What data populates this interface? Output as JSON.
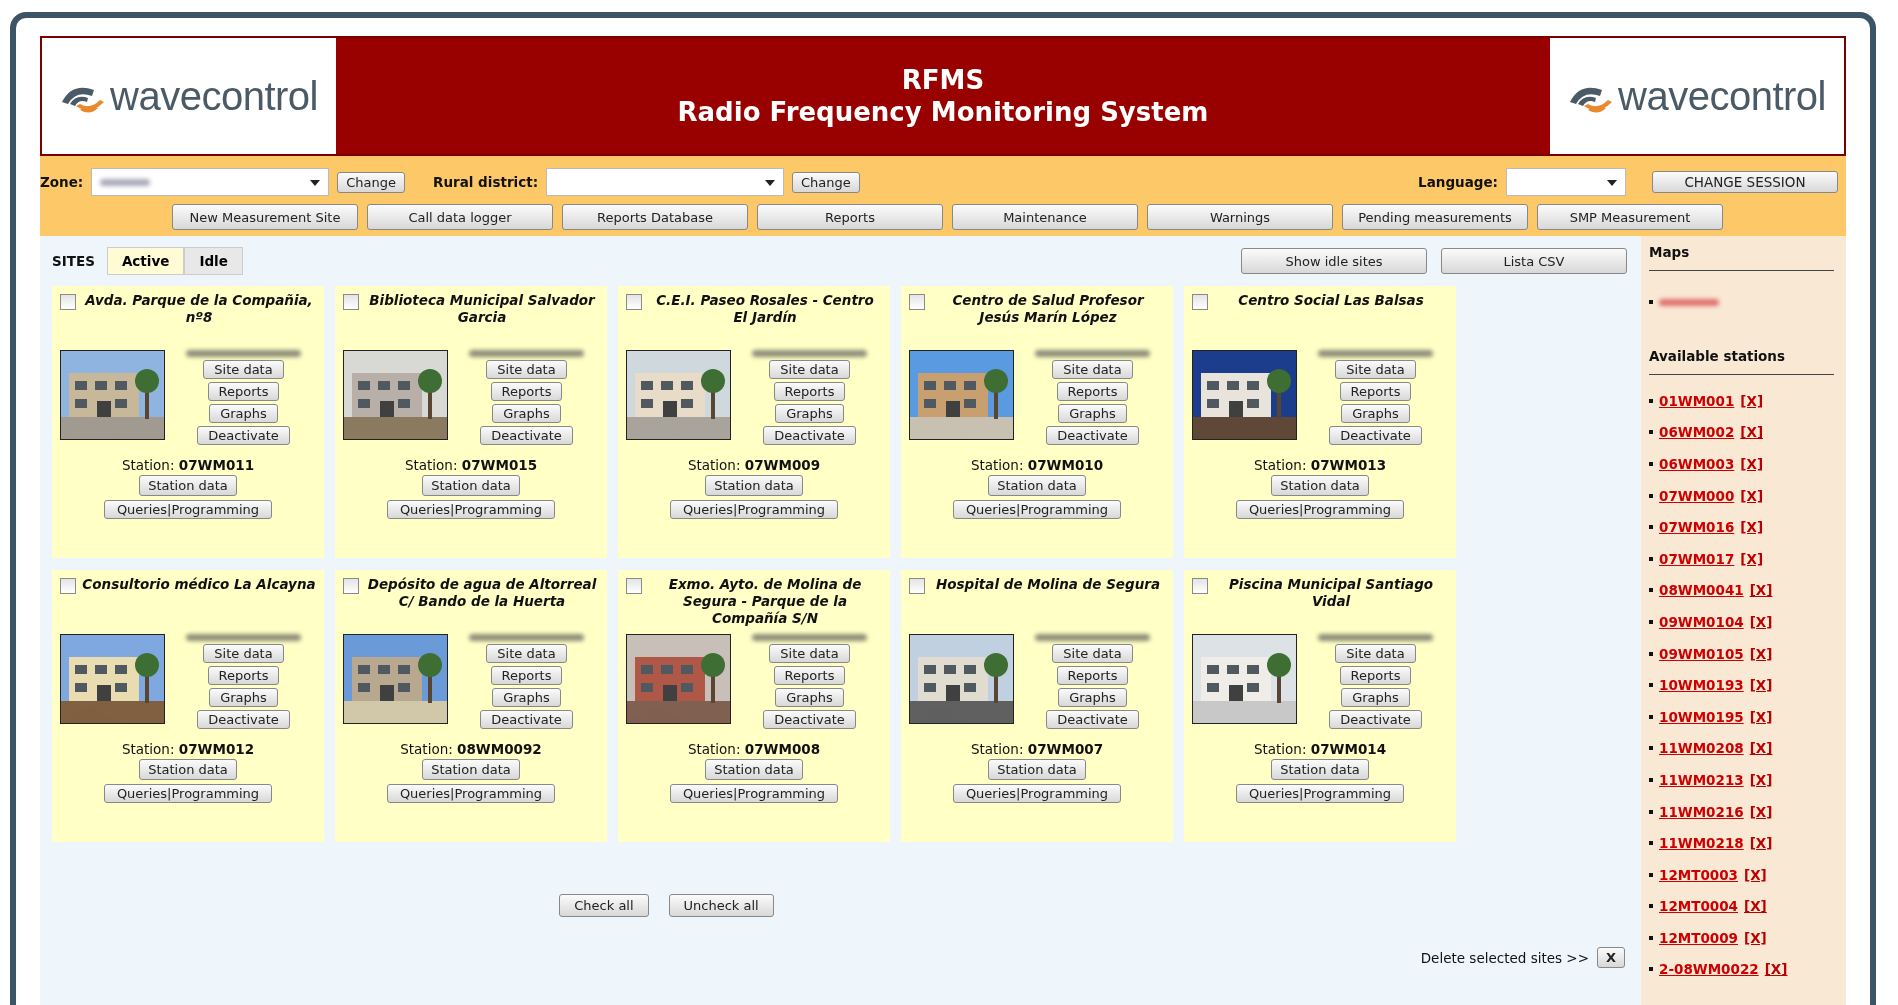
{
  "header": {
    "logo_left": "wavecontrol",
    "title": "RFMS",
    "subtitle": "Radio Frequency Monitoring System",
    "logo_right": "wavecontrol"
  },
  "filters": {
    "zone_label": "Zone:",
    "zone_button": "Change",
    "district_label": "Rural district:",
    "district_button": "Change",
    "language_label": "Language:",
    "session_button": "CHANGE SESSION"
  },
  "nav": [
    "New Measurement Site",
    "Call data logger",
    "Reports Database",
    "Reports",
    "Maintenance",
    "Warnings",
    "Pending measurements",
    "SMP Measurement"
  ],
  "sites_label": "SITES",
  "tabs": [
    {
      "label": "Active",
      "selected": true
    },
    {
      "label": "Idle",
      "selected": false
    }
  ],
  "actions": [
    "Show idle sites",
    "Lista CSV"
  ],
  "sites": [
    {
      "name": "Avda. Parque de la Compañia, nº8",
      "checked": false,
      "buttons": [
        "Site data",
        "Reports",
        "Graphs",
        "Deactivate"
      ],
      "station_label": "Station:",
      "station": "07WM011",
      "station_button": "Station data",
      "queries": "Queries|Programming"
    },
    {
      "name": "Biblioteca Municipal Salvador Garcia",
      "checked": false,
      "buttons": [
        "Site data",
        "Reports",
        "Graphs",
        "Deactivate"
      ],
      "station_label": "Station:",
      "station": "07WM015",
      "station_button": "Station data",
      "queries": "Queries|Programming"
    },
    {
      "name": "C.E.I. Paseo Rosales - Centro El Jardín",
      "checked": false,
      "buttons": [
        "Site data",
        "Reports",
        "Graphs",
        "Deactivate"
      ],
      "station_label": "Station:",
      "station": "07WM009",
      "station_button": "Station data",
      "queries": "Queries|Programming"
    },
    {
      "name": "Centro de Salud Profesor Jesús Marín López",
      "checked": false,
      "buttons": [
        "Site data",
        "Reports",
        "Graphs",
        "Deactivate"
      ],
      "station_label": "Station:",
      "station": "07WM010",
      "station_button": "Station data",
      "queries": "Queries|Programming"
    },
    {
      "name": "Centro Social Las Balsas",
      "checked": false,
      "buttons": [
        "Site data",
        "Reports",
        "Graphs",
        "Deactivate"
      ],
      "station_label": "Station:",
      "station": "07WM013",
      "station_button": "Station data",
      "queries": "Queries|Programming"
    },
    {
      "name": "Consultorio médico La Alcayna",
      "checked": false,
      "buttons": [
        "Site data",
        "Reports",
        "Graphs",
        "Deactivate"
      ],
      "station_label": "Station:",
      "station": "07WM012",
      "station_button": "Station data",
      "queries": "Queries|Programming"
    },
    {
      "name": "Depósito de agua de Altorreal C/ Bando de la Huerta",
      "checked": false,
      "buttons": [
        "Site data",
        "Reports",
        "Graphs",
        "Deactivate"
      ],
      "station_label": "Station:",
      "station": "08WM0092",
      "station_button": "Station data",
      "queries": "Queries|Programming"
    },
    {
      "name": "Exmo. Ayto. de Molina de Segura - Parque de la Compañía S/N",
      "checked": false,
      "buttons": [
        "Site data",
        "Reports",
        "Graphs",
        "Deactivate"
      ],
      "station_label": "Station:",
      "station": "07WM008",
      "station_button": "Station data",
      "queries": "Queries|Programming"
    },
    {
      "name": "Hospital de Molina de Segura",
      "checked": false,
      "buttons": [
        "Site data",
        "Reports",
        "Graphs",
        "Deactivate"
      ],
      "station_label": "Station:",
      "station": "07WM007",
      "station_button": "Station data",
      "queries": "Queries|Programming"
    },
    {
      "name": "Piscina Municipal Santiago Vidal",
      "checked": false,
      "buttons": [
        "Site data",
        "Reports",
        "Graphs",
        "Deactivate"
      ],
      "station_label": "Station:",
      "station": "07WM014",
      "station_button": "Station data",
      "queries": "Queries|Programming"
    }
  ],
  "bulk": [
    "Check all",
    "Uncheck all"
  ],
  "delete": {
    "label": "Delete selected sites >>",
    "button": "X"
  },
  "sidebar": {
    "maps_title": "Maps",
    "stations_title": "Available stations",
    "stations": [
      {
        "name": "01WM001",
        "remove": "[X]"
      },
      {
        "name": "06WM002",
        "remove": "[X]"
      },
      {
        "name": "06WM003",
        "remove": "[X]"
      },
      {
        "name": "07WM000",
        "remove": "[X]"
      },
      {
        "name": "07WM016",
        "remove": "[X]"
      },
      {
        "name": "07WM017",
        "remove": "[X]"
      },
      {
        "name": "08WM0041",
        "remove": "[X]"
      },
      {
        "name": "09WM0104",
        "remove": "[X]"
      },
      {
        "name": "09WM0105",
        "remove": "[X]"
      },
      {
        "name": "10WM0193",
        "remove": "[X]"
      },
      {
        "name": "10WM0195",
        "remove": "[X]"
      },
      {
        "name": "11WM0208",
        "remove": "[X]"
      },
      {
        "name": "11WM0213",
        "remove": "[X]"
      },
      {
        "name": "11WM0216",
        "remove": "[X]"
      },
      {
        "name": "11WM0218",
        "remove": "[X]"
      },
      {
        "name": "12MT0003",
        "remove": "[X]"
      },
      {
        "name": "12MT0004",
        "remove": "[X]"
      },
      {
        "name": "12MT0009",
        "remove": "[X]"
      },
      {
        "name": "2-08WM0022",
        "remove": "[X]"
      }
    ]
  }
}
